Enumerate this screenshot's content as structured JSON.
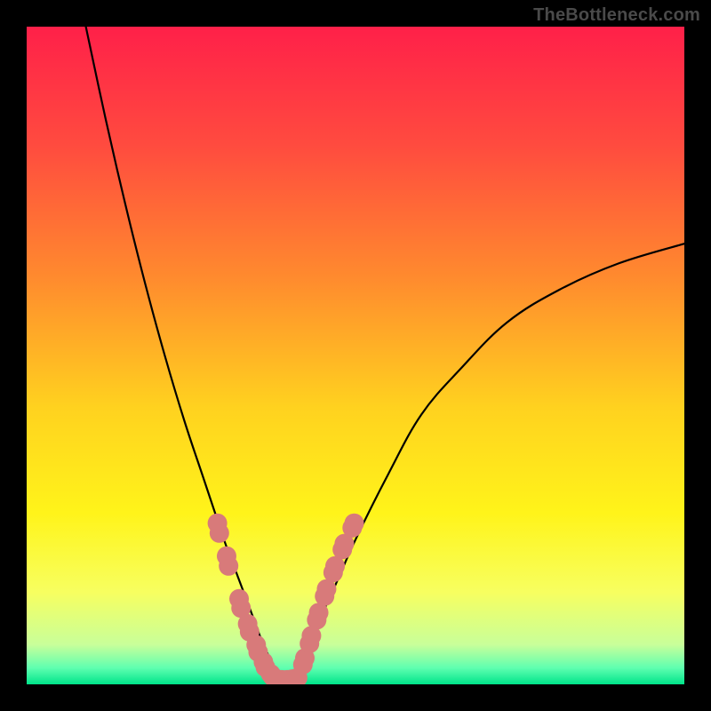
{
  "watermark": "TheBottleneck.com",
  "chart_data": {
    "type": "line",
    "title": "",
    "xlabel": "",
    "ylabel": "",
    "xlim": [
      0,
      100
    ],
    "ylim": [
      0,
      100
    ],
    "grid": false,
    "legend": false,
    "series": [
      {
        "name": "curve-left",
        "color": "#000000",
        "x": [
          9,
          12,
          15,
          18,
          21,
          24,
          27,
          30,
          31.5,
          33,
          34.5,
          36,
          37.5
        ],
        "values": [
          100,
          86,
          73,
          61,
          50,
          40,
          31,
          22,
          18,
          14,
          10,
          6,
          3
        ]
      },
      {
        "name": "curve-right",
        "color": "#000000",
        "x": [
          41,
          43,
          46,
          50,
          55,
          60,
          66,
          73,
          81,
          90,
          100
        ],
        "values": [
          3,
          7,
          13,
          22,
          32,
          41,
          48,
          55,
          60,
          64,
          67
        ]
      },
      {
        "name": "markers-left",
        "type": "scatter",
        "color": "#d87a7a",
        "x": [
          29.0,
          29.3,
          30.4,
          30.7,
          32.3,
          32.6,
          33.6,
          33.9,
          34.9,
          35.2,
          36.0,
          36.3,
          37.1,
          37.4
        ],
        "values": [
          24.5,
          23.0,
          19.5,
          18.0,
          13.0,
          11.6,
          9.2,
          8.0,
          6.0,
          4.9,
          3.4,
          2.6,
          1.6,
          1.2
        ]
      },
      {
        "name": "markers-bottom",
        "type": "scatter",
        "color": "#d87a7a",
        "x": [
          38.0,
          38.8,
          39.6,
          40.4,
          41.2
        ],
        "values": [
          0.8,
          0.7,
          0.7,
          0.8,
          1.0
        ]
      },
      {
        "name": "markers-right",
        "type": "scatter",
        "color": "#d87a7a",
        "x": [
          42.0,
          42.3,
          43.0,
          43.3,
          44.1,
          44.4,
          45.3,
          45.6,
          46.6,
          46.9,
          48.0,
          48.3,
          49.5,
          49.8
        ],
        "values": [
          3.0,
          4.0,
          6.2,
          7.4,
          9.8,
          10.9,
          13.4,
          14.5,
          17.0,
          18.0,
          20.5,
          21.4,
          23.8,
          24.5
        ]
      }
    ],
    "background_gradient": {
      "stops": [
        {
          "offset": 0.0,
          "color": "#ff2049"
        },
        {
          "offset": 0.18,
          "color": "#ff4b3f"
        },
        {
          "offset": 0.38,
          "color": "#ff8a2e"
        },
        {
          "offset": 0.58,
          "color": "#ffd21f"
        },
        {
          "offset": 0.74,
          "color": "#fff41a"
        },
        {
          "offset": 0.86,
          "color": "#f7ff60"
        },
        {
          "offset": 0.94,
          "color": "#c8ff9a"
        },
        {
          "offset": 0.975,
          "color": "#5fffb0"
        },
        {
          "offset": 1.0,
          "color": "#00e48a"
        }
      ]
    }
  }
}
